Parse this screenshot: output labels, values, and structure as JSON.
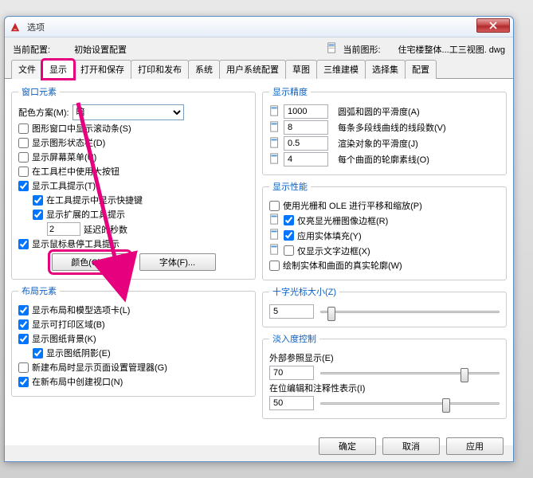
{
  "title": "选项",
  "toprow": {
    "current_profile_label": "当前配置:",
    "current_profile_value": "初始设置配置",
    "current_drawing_label": "当前图形:",
    "current_drawing_value": "住宅楼整体...工三视图. dwg"
  },
  "tabs": [
    "文件",
    "显示",
    "打开和保存",
    "打印和发布",
    "系统",
    "用户系统配置",
    "草图",
    "三维建模",
    "选择集",
    "配置"
  ],
  "active_tab_index": 1,
  "left": {
    "window_elements": {
      "legend": "窗口元素",
      "color_scheme_label": "配色方案(M):",
      "color_scheme_value": "暗",
      "scrollbars": "图形窗口中显示滚动条(S)",
      "status_bar": "显示图形状态栏(D)",
      "screen_menu": "显示屏幕菜单(U)",
      "large_toolbar": "在工具栏中使用大按钮",
      "show_tooltips": "显示工具提示(T)",
      "show_shortcut": "在工具提示中显示快捷键",
      "ext_tooltips": "显示扩展的工具提示",
      "delay_seconds_value": "2",
      "delay_seconds_label": "延迟的秒数",
      "mouse_tooltips": "显示鼠标悬停工具提示",
      "color_btn": "颜色(C)...",
      "font_btn": "字体(F)..."
    },
    "layout_elements": {
      "legend": "布局元素",
      "layout_tabs": "显示布局和模型选项卡(L)",
      "printable_area": "显示可打印区域(B)",
      "paper_bg": "显示图纸背景(K)",
      "paper_shadow": "显示图纸阴影(E)",
      "page_setup": "新建布局时显示页面设置管理器(G)",
      "create_viewport": "在新布局中创建视口(N)"
    }
  },
  "right": {
    "display_precision": {
      "legend": "显示精度",
      "arc_smooth_value": "1000",
      "arc_smooth_label": "圆弧和圆的平滑度(A)",
      "polyline_seg_value": "8",
      "polyline_seg_label": "每条多段线曲线的线段数(V)",
      "render_smooth_value": "0.5",
      "render_smooth_label": "渲染对象的平滑度(J)",
      "surface_contour_value": "4",
      "surface_contour_label": "每个曲面的轮廓素线(O)"
    },
    "display_performance": {
      "legend": "显示性能",
      "pan_zoom": "使用光栅和 OLE 进行平移和缩放(P)",
      "highlight_raster": "仅亮显光栅图像边框(R)",
      "solid_fill": "应用实体填充(Y)",
      "text_frame": "仅显示文字边框(X)",
      "true_silhouette": "绘制实体和曲面的真实轮廓(W)"
    },
    "crosshair": {
      "legend": "十字光标大小(Z)",
      "value": "5"
    },
    "fade": {
      "legend": "淡入度控制",
      "xref_label": "外部参照显示(E)",
      "xref_value": "70",
      "inplace_label": "在位编辑和注释性表示(I)",
      "inplace_value": "50"
    }
  },
  "footer": {
    "ok": "确定",
    "cancel": "取消",
    "apply": "应用"
  }
}
